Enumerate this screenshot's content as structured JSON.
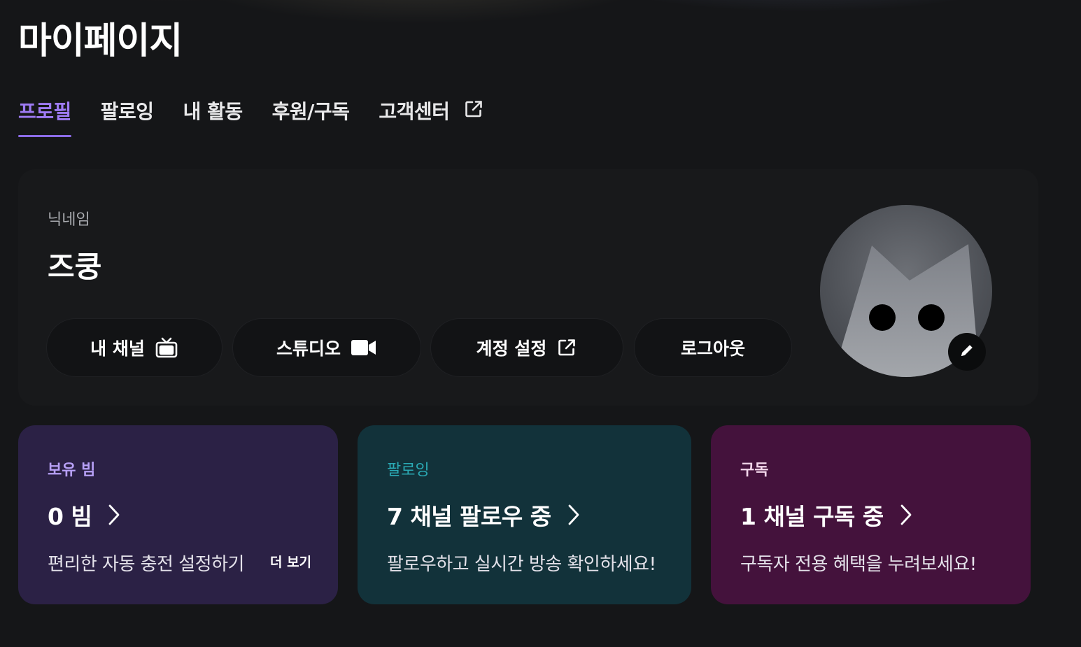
{
  "page": {
    "title": "마이페이지"
  },
  "tabs": [
    {
      "label": "프로필",
      "active": true
    },
    {
      "label": "팔로잉",
      "active": false
    },
    {
      "label": "내 활동",
      "active": false
    },
    {
      "label": "후원/구독",
      "active": false
    },
    {
      "label": "고객센터",
      "active": false,
      "icon": "external-link-icon"
    }
  ],
  "profile": {
    "nickname_label": "닉네임",
    "nickname": "즈쿵",
    "actions": [
      {
        "label": "내 채널",
        "icon": "tv-icon"
      },
      {
        "label": "스튜디오",
        "icon": "video-camera-icon"
      },
      {
        "label": "계정 설정",
        "icon": "external-link-icon"
      },
      {
        "label": "로그아웃",
        "icon": ""
      }
    ],
    "avatar_edit_icon": "pencil-icon"
  },
  "cards": {
    "beam": {
      "label": "보유 빔",
      "value": "0 빔",
      "desc": "편리한 자동 충전 설정하기",
      "more": "더 보기",
      "color": "#2b2145"
    },
    "following": {
      "label": "팔로잉",
      "value": "7 채널 팔로우 중",
      "desc": "팔로우하고 실시간 방송 확인하세요!",
      "color": "#12323a"
    },
    "subscription": {
      "label": "구독",
      "value": "1 채널 구독 중",
      "desc": "구독자 전용 혜택을 누려보세요!",
      "color": "#44123c"
    }
  },
  "colors": {
    "accent": "#9e7bf4",
    "background": "#151618"
  }
}
